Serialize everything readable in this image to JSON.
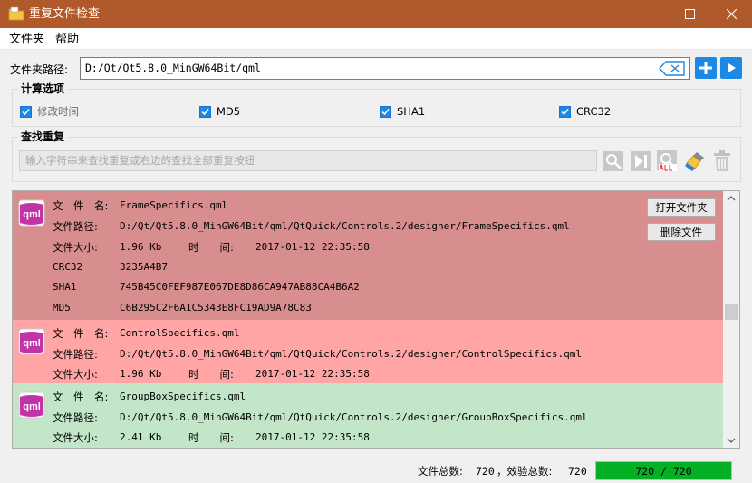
{
  "window": {
    "title": "重复文件检查"
  },
  "menu": {
    "items": [
      "文件夹",
      "帮助"
    ]
  },
  "path": {
    "label": "文件夹路径:",
    "value": "D:/Qt/Qt5.8.0_MinGW64Bit/qml"
  },
  "options": {
    "title": "计算选项",
    "checkboxes": [
      {
        "label": "修改时间",
        "checked": true
      },
      {
        "label": "MD5",
        "checked": true
      },
      {
        "label": "SHA1",
        "checked": true
      },
      {
        "label": "CRC32",
        "checked": true
      }
    ]
  },
  "search": {
    "title": "查找重复",
    "placeholder": "输入字符串来查找重复或右边的查找全部重复按钮"
  },
  "results": [
    {
      "name_label": "文　件　名:",
      "name": "FrameSpecifics.qml",
      "path_label": "文件路径:",
      "path": "D:/Qt/Qt5.8.0_MinGW64Bit/qml/QtQuick/Controls.2/designer/FrameSpecifics.qml",
      "size_label": "文件大小:",
      "size": "1.96 Kb",
      "time_label": "时　　间:",
      "time": "2017-01-12 22:35:58",
      "crc_label": "CRC32",
      "crc": "3235A4B7",
      "sha_label": "SHA1",
      "sha": "745B45C0FEF987E067DE8D86CA947AB88CA4B6A2",
      "md5_label": "MD5",
      "md5": "C6B295C2F6A1C5343E8FC19AD9A78C83",
      "open_label": "打开文件夹",
      "delete_label": "删除文件",
      "color": "#d88e8e"
    },
    {
      "name_label": "文　件　名:",
      "name": "ControlSpecifics.qml",
      "path_label": "文件路径:",
      "path": "D:/Qt/Qt5.8.0_MinGW64Bit/qml/QtQuick/Controls.2/designer/ControlSpecifics.qml",
      "size_label": "文件大小:",
      "size": "1.96 Kb",
      "time_label": "时　　间:",
      "time": "2017-01-12 22:35:58",
      "color": "#ffa5a5"
    },
    {
      "name_label": "文　件　名:",
      "name": "GroupBoxSpecifics.qml",
      "path_label": "文件路径:",
      "path": "D:/Qt/Qt5.8.0_MinGW64Bit/qml/QtQuick/Controls.2/designer/GroupBoxSpecifics.qml",
      "size_label": "文件大小:",
      "size": "2.41 Kb",
      "time_label": "时　　间:",
      "time": "2017-01-12 22:35:58",
      "color": "#c3e6c9"
    }
  ],
  "status": {
    "total_label": "文件总数:",
    "total": "720",
    "checked_label": "，效验总数:",
    "checked": "720",
    "progress_text": "720 / 720",
    "progress_fraction": 1.0
  },
  "colors": {
    "titlebar": "#b0592a",
    "accent": "#1e88e5",
    "progress": "#06b025"
  }
}
